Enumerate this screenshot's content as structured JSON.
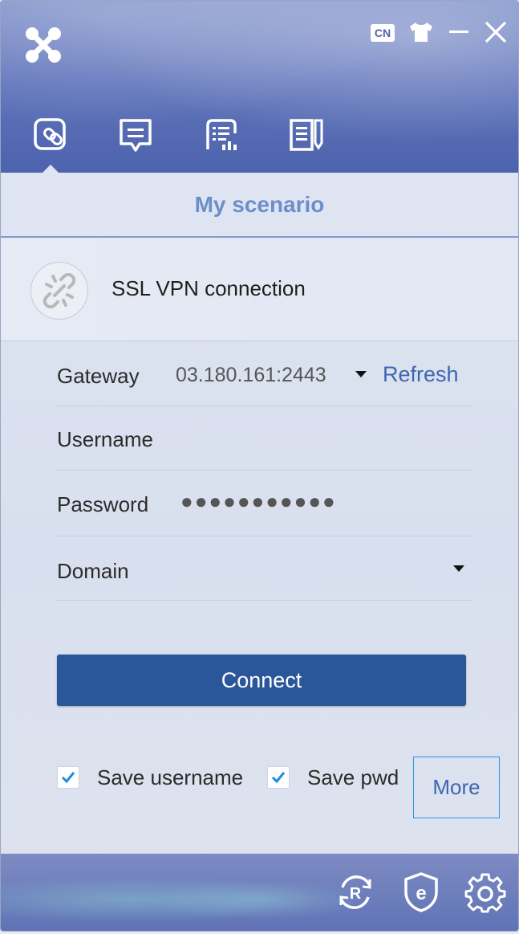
{
  "header": {
    "lang_label": "CN",
    "tabs": [
      {
        "name": "scenario-tab",
        "icon": "link-icon"
      },
      {
        "name": "message-tab",
        "icon": "message-icon"
      },
      {
        "name": "list-tab",
        "icon": "list-icon"
      },
      {
        "name": "notes-tab",
        "icon": "notes-icon"
      }
    ]
  },
  "scenario": {
    "title": "My scenario",
    "connection_title": "SSL VPN connection"
  },
  "form": {
    "gateway_label": "Gateway",
    "gateway_value": "03.180.161:2443",
    "refresh_label": "Refresh",
    "username_label": "Username",
    "username_value": "",
    "password_label": "Password",
    "password_mask": "●●●●●●●●●●●",
    "domain_label": "Domain",
    "domain_value": ""
  },
  "actions": {
    "connect_label": "Connect",
    "save_username_label": "Save username",
    "save_username_checked": true,
    "save_pwd_label": "Save pwd",
    "save_pwd_checked": true,
    "more_label": "More"
  },
  "footer": {
    "icons": [
      "refresh-r-icon",
      "browser-shield-icon",
      "settings-gear-icon"
    ]
  },
  "colors": {
    "accent": "#2b579a",
    "link": "#3f66b0",
    "header": "#5a6db6",
    "check": "#1c8de0"
  }
}
